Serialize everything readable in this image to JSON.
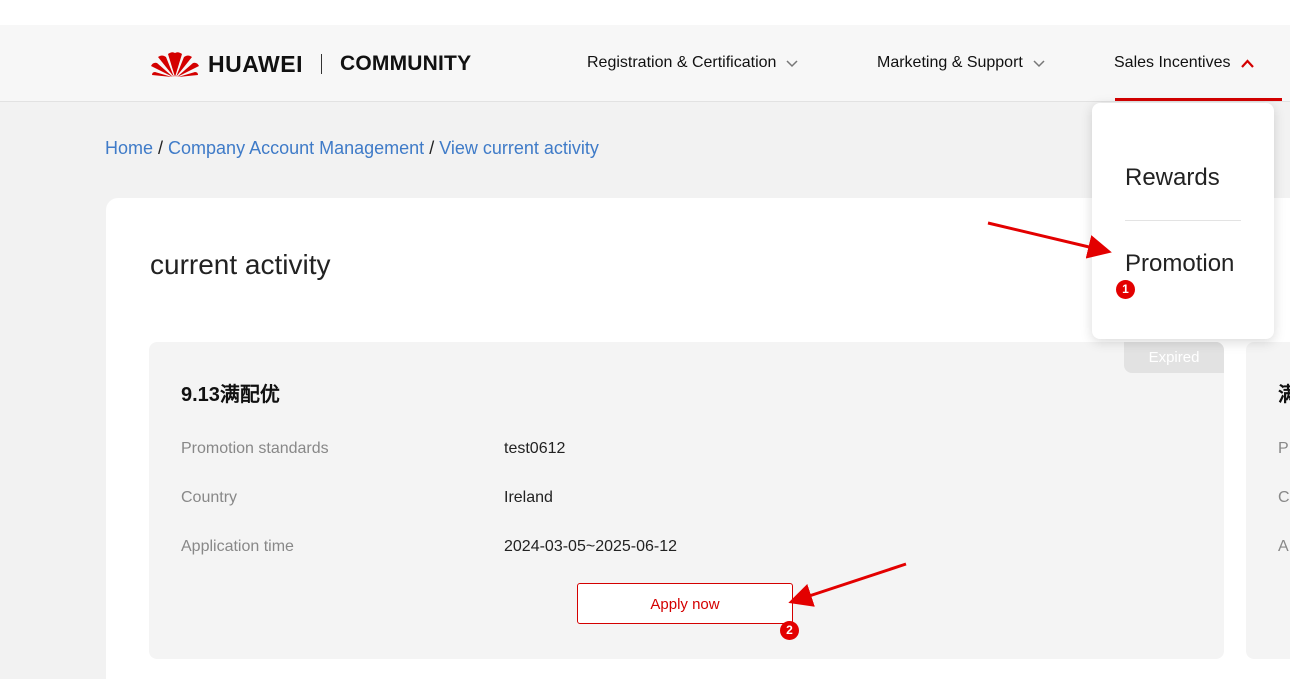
{
  "header": {
    "brand": "HUAWEI",
    "community": "COMMUNITY",
    "nav": [
      {
        "label": "Registration & Certification",
        "chevron": "chevron-down-icon"
      },
      {
        "label": "Marketing & Support",
        "chevron": "chevron-down-icon"
      },
      {
        "label": "Sales Incentives",
        "chevron": "chevron-up-icon",
        "active": true
      }
    ],
    "accent_color": "#d40000"
  },
  "breadcrumb": {
    "items": [
      "Home",
      "Company Account Management",
      "View current activity"
    ],
    "separator": "/"
  },
  "page_title": "current activity",
  "dropdown": {
    "items": [
      "Rewards",
      "Promotion"
    ]
  },
  "activity": {
    "status": "Expired",
    "title": "9.13满配优",
    "rows": [
      {
        "label": "Promotion standards",
        "value": "test0612"
      },
      {
        "label": "Country",
        "value": "Ireland"
      },
      {
        "label": "Application time",
        "value": "2024-03-05~2025-06-12"
      }
    ],
    "apply_label": "Apply now"
  },
  "next_activity": {
    "title_partial": "满",
    "row_initials": [
      "P",
      "C",
      "A"
    ]
  },
  "annotations": {
    "marker1": "1",
    "marker2": "2",
    "color": "#e30000"
  }
}
